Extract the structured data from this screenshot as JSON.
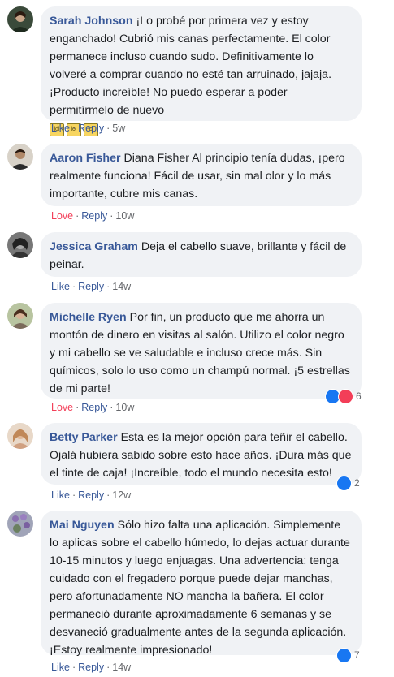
{
  "comments": [
    {
      "name": "Sarah Johnson",
      "text": "¡Lo probé por primera vez y estoy enganchado! Cubrió mis canas perfectamente. El color permanece incluso cuando sudo. Definitivamente lo volveré a comprar cuando no esté tan arruinado, jajaja. ¡Producto increíble! No puedo esperar a poder permitírmelo de nuevo",
      "emojis": [
        "lol",
        "lol",
        "lol"
      ],
      "reaction": "Like",
      "reply": "Reply",
      "time": "5w",
      "reaction_count": ""
    },
    {
      "name": "Aaron Fisher",
      "text": "Diana Fisher Al principio tenía dudas, ¡pero realmente funciona! Fácil de usar, sin mal olor y lo más importante, cubre mis canas.",
      "reaction": "Love",
      "reply": "Reply",
      "time": "10w",
      "reaction_count": ""
    },
    {
      "name": "Jessica Graham",
      "text": "Deja el cabello suave, brillante y fácil de peinar.",
      "reaction": "Like",
      "reply": "Reply",
      "time": "14w",
      "reaction_count": ""
    },
    {
      "name": "Michelle Ryen",
      "text": "Por fin, un producto que me ahorra un montón de dinero en visitas al salón. Utilizo el color negro y mi cabello se ve saludable e incluso crece más. Sin químicos, solo lo uso como un champú normal. ¡5 estrellas de mi parte!",
      "reaction": "Love",
      "reply": "Reply",
      "time": "10w",
      "reaction_count": "6",
      "reaction_icons": [
        "like-icon",
        "love-icon"
      ]
    },
    {
      "name": "Betty Parker",
      "text": "Esta es la mejor opción para teñir el cabello. Ojalá hubiera sabido sobre esto hace años. ¡Dura más que el tinte de caja! ¡Increíble, todo el mundo necesita esto!",
      "reaction": "Like",
      "reply": "Reply",
      "time": "12w",
      "reaction_count": "2",
      "reaction_icons": [
        "like-icon"
      ]
    },
    {
      "name": "Mai Nguyen",
      "text": "Sólo hizo falta una aplicación. Simplemente lo aplicas sobre el cabello húmedo, lo dejas actuar durante 10-15 minutos y luego enjuagas. Una advertencia: tenga cuidado con el fregadero porque puede dejar manchas, pero afortunadamente NO mancha la bañera. El color permaneció durante aproximadamente 6 semanas y se desvaneció gradualmente antes de la segunda aplicación. ¡Estoy realmente impresionado!",
      "reaction": "Like",
      "reply": "Reply",
      "time": "14w",
      "reaction_count": "7",
      "reaction_icons": [
        "like-icon"
      ]
    }
  ],
  "colors": {
    "name": "#385898",
    "love": "#f33e58",
    "like_icon": "#1877f2",
    "bubble": "#f0f2f5",
    "meta": "#65676b"
  },
  "ui": {
    "separator": "·"
  }
}
